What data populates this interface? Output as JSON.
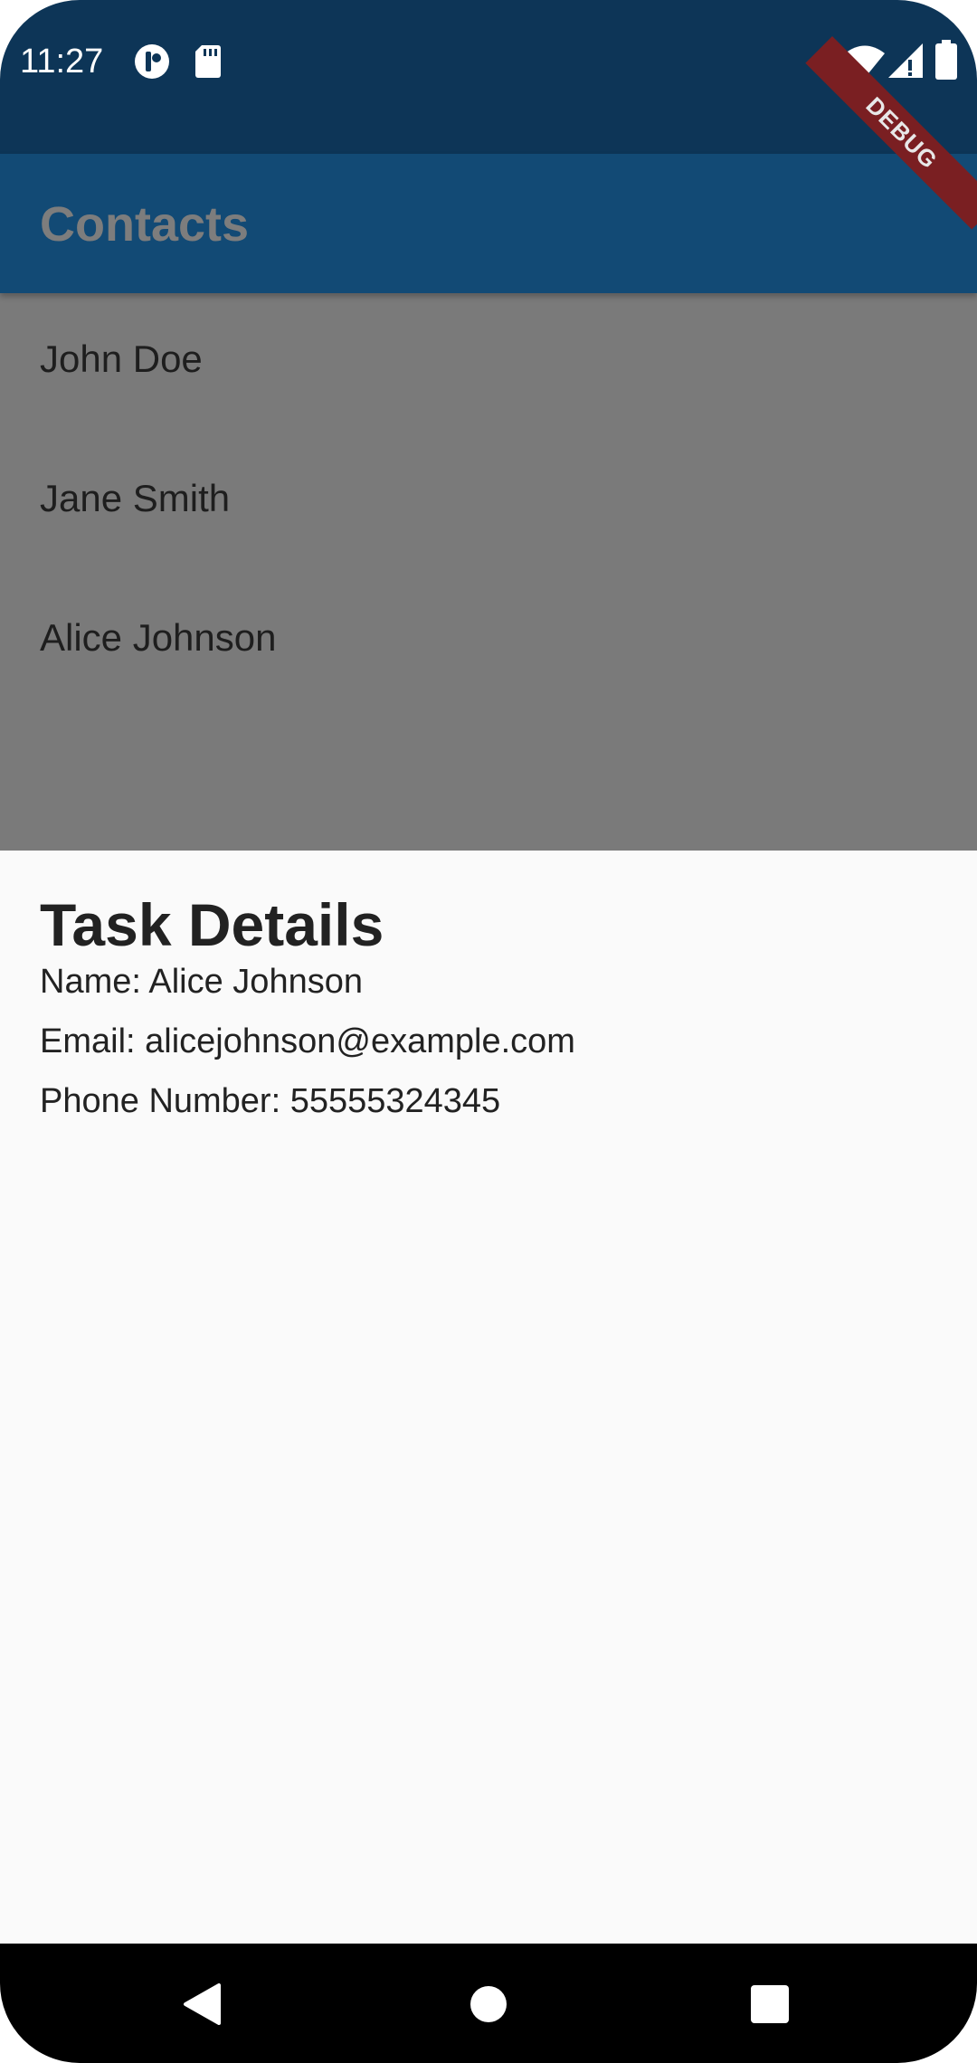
{
  "status_bar": {
    "time": "11:27",
    "left_icons": [
      "notification-app-icon",
      "sd-card-icon"
    ],
    "right_icons": [
      "wifi-icon",
      "cell-signal-icon",
      "battery-icon"
    ]
  },
  "debug_banner": {
    "label": "DEBUG"
  },
  "app_bar": {
    "title": "Contacts"
  },
  "contacts": [
    {
      "name": "John Doe"
    },
    {
      "name": "Jane Smith"
    },
    {
      "name": "Alice Johnson"
    }
  ],
  "task_details": {
    "title": "Task Details",
    "name_line": "Name: Alice Johnson",
    "email_line": "Email: alicejohnson@example.com",
    "phone_line": "Phone Number: 55555324345"
  },
  "nav_bar": {
    "buttons": [
      "back-icon",
      "home-icon",
      "recents-icon"
    ]
  },
  "colors": {
    "status_bar": "#0d3557",
    "app_bar": "#124a75",
    "scrim_list": "#7a7a7a",
    "sheet": "#fafafa",
    "nav_bar": "#000000",
    "debug": "#7a1f22"
  }
}
